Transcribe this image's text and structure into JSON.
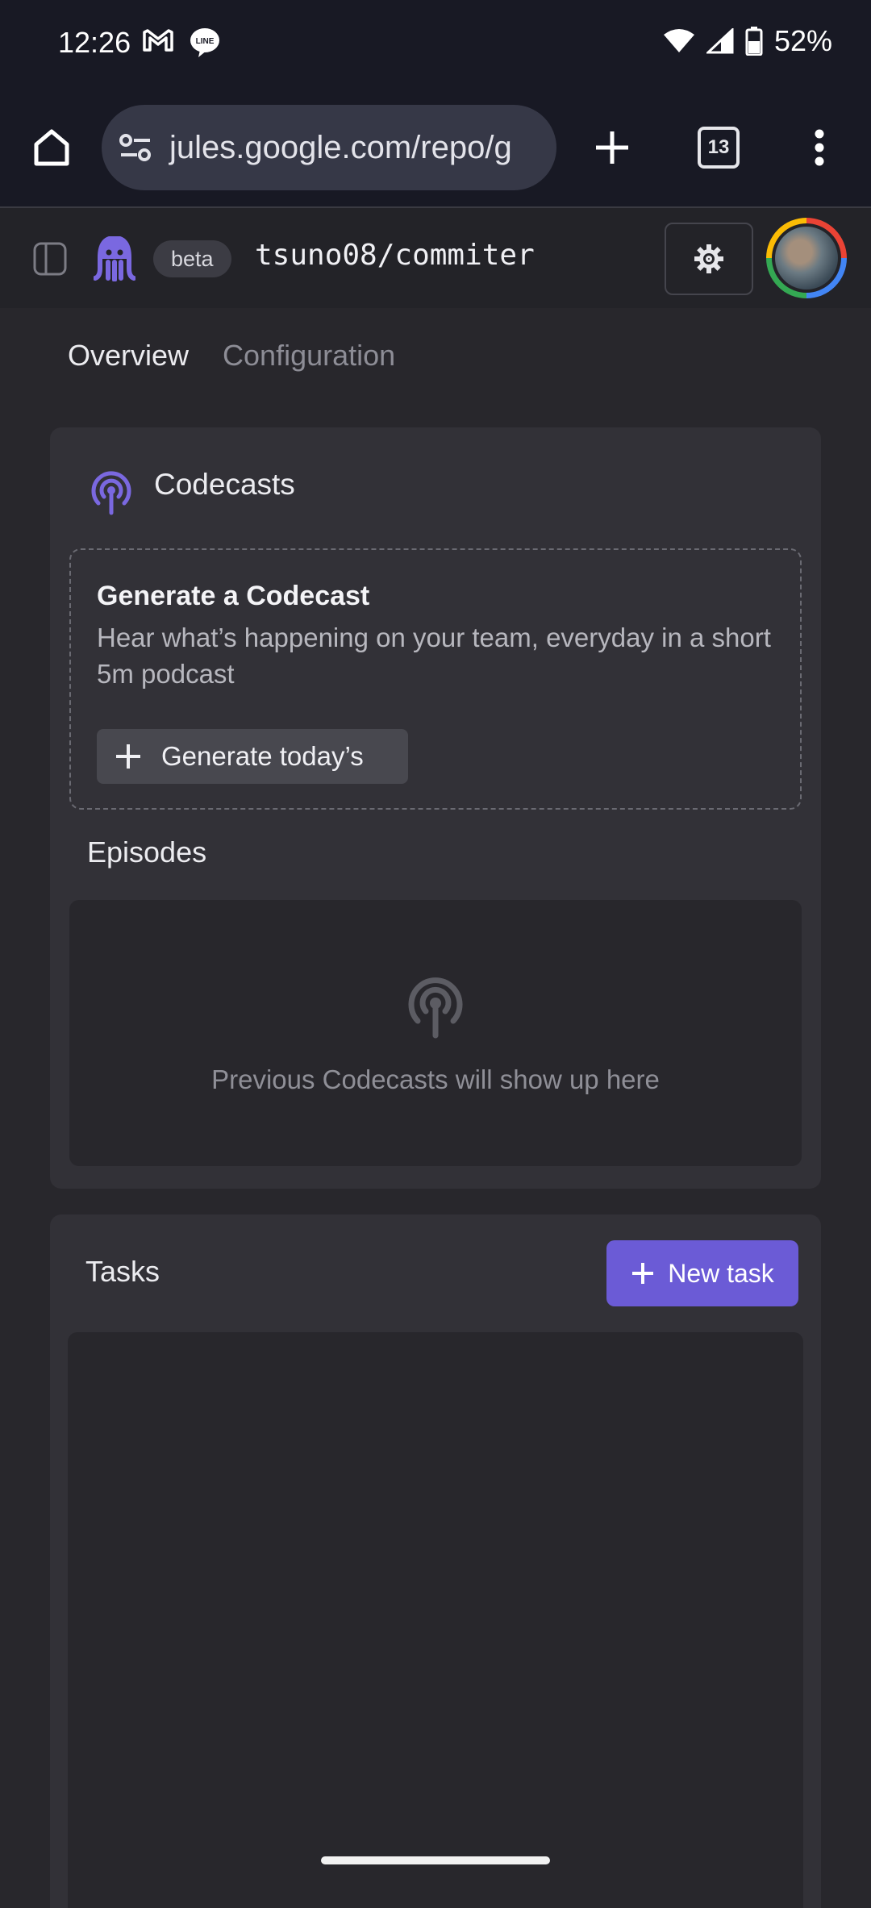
{
  "status_bar": {
    "time": "12:26",
    "battery": "52%",
    "icons": [
      "gmail-icon",
      "line-icon",
      "wifi-icon",
      "signal-icon",
      "battery-icon"
    ]
  },
  "browser": {
    "url": "jules.google.com/repo/g",
    "tab_count": "13"
  },
  "app_header": {
    "badge": "beta",
    "repo": "tsuno08/commiter"
  },
  "tabs": [
    {
      "label": "Overview",
      "active": true
    },
    {
      "label": "Configuration",
      "active": false
    }
  ],
  "codecasts": {
    "title": "Codecasts",
    "generate": {
      "title": "Generate a Codecast",
      "description": "Hear what’s happening on your team, everyday in a short 5m podcast",
      "button_label": "Generate today’s"
    },
    "episodes": {
      "title": "Episodes",
      "empty_text": "Previous Codecasts will show up here"
    }
  },
  "tasks": {
    "title": "Tasks",
    "new_task_label": "New task"
  },
  "colors": {
    "accent": "#6b5bd6",
    "background": "#28272c",
    "card": "#323137",
    "browser_chrome": "#181924"
  }
}
